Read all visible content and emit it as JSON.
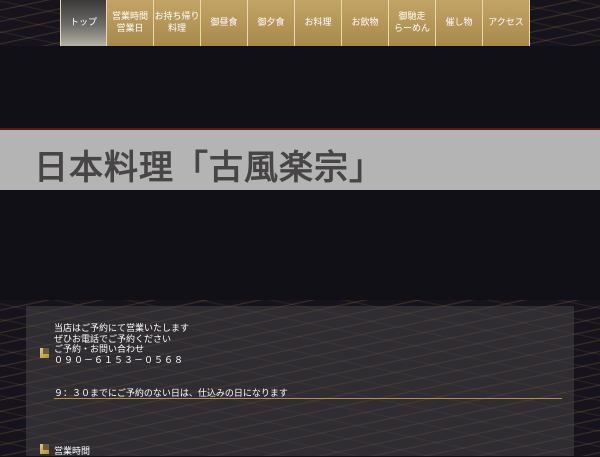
{
  "nav": {
    "items": [
      {
        "label": "トップ",
        "active": true
      },
      {
        "label": "営業時間\n営業日",
        "active": false
      },
      {
        "label": "お持ち帰り\n料理",
        "active": false
      },
      {
        "label": "御昼食",
        "active": false
      },
      {
        "label": "御夕食",
        "active": false
      },
      {
        "label": "お料理",
        "active": false
      },
      {
        "label": "お飲物",
        "active": false
      },
      {
        "label": "御馳走\nらーめん",
        "active": false
      },
      {
        "label": "催し物",
        "active": false
      },
      {
        "label": "アクセス",
        "active": false
      }
    ]
  },
  "title": "日本料理「古風楽宗」",
  "info": {
    "line1": "当店はご予約にて営業いたします",
    "line2": "ぜひお電話でご予約ください",
    "line3": "ご予約・お問い合わせ",
    "phone": "０９０－６１５３－０５６８",
    "reservation_note": "９：３０までにご予約のない日は、仕込みの日になります",
    "hours_heading": "営業時間"
  },
  "colors": {
    "nav_gold": "#b69a5a",
    "title_bg": "#b4b4b4",
    "accent_rule": "#b0913e"
  }
}
